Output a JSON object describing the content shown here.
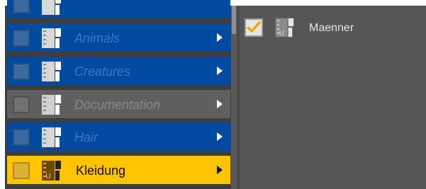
{
  "content_library": {
    "folders": [
      {
        "label": "",
        "state": "blue"
      },
      {
        "label": "Animals",
        "state": "blue"
      },
      {
        "label": "Creatures",
        "state": "blue"
      },
      {
        "label": "Documentation",
        "state": "gray"
      },
      {
        "label": "Hair",
        "state": "blue"
      },
      {
        "label": "Kleidung",
        "state": "selected"
      }
    ],
    "subfolder": {
      "label": "Maenner",
      "checked": true
    }
  },
  "colors": {
    "row_blue": "#004aa0",
    "row_gray": "#5f5f5f",
    "row_selected": "#ffc400",
    "panel": "#565656"
  },
  "icons": {
    "folder_icon": "book-icon",
    "expand_icon": "chevron-right-icon",
    "check_icon": "checkmark-icon"
  }
}
